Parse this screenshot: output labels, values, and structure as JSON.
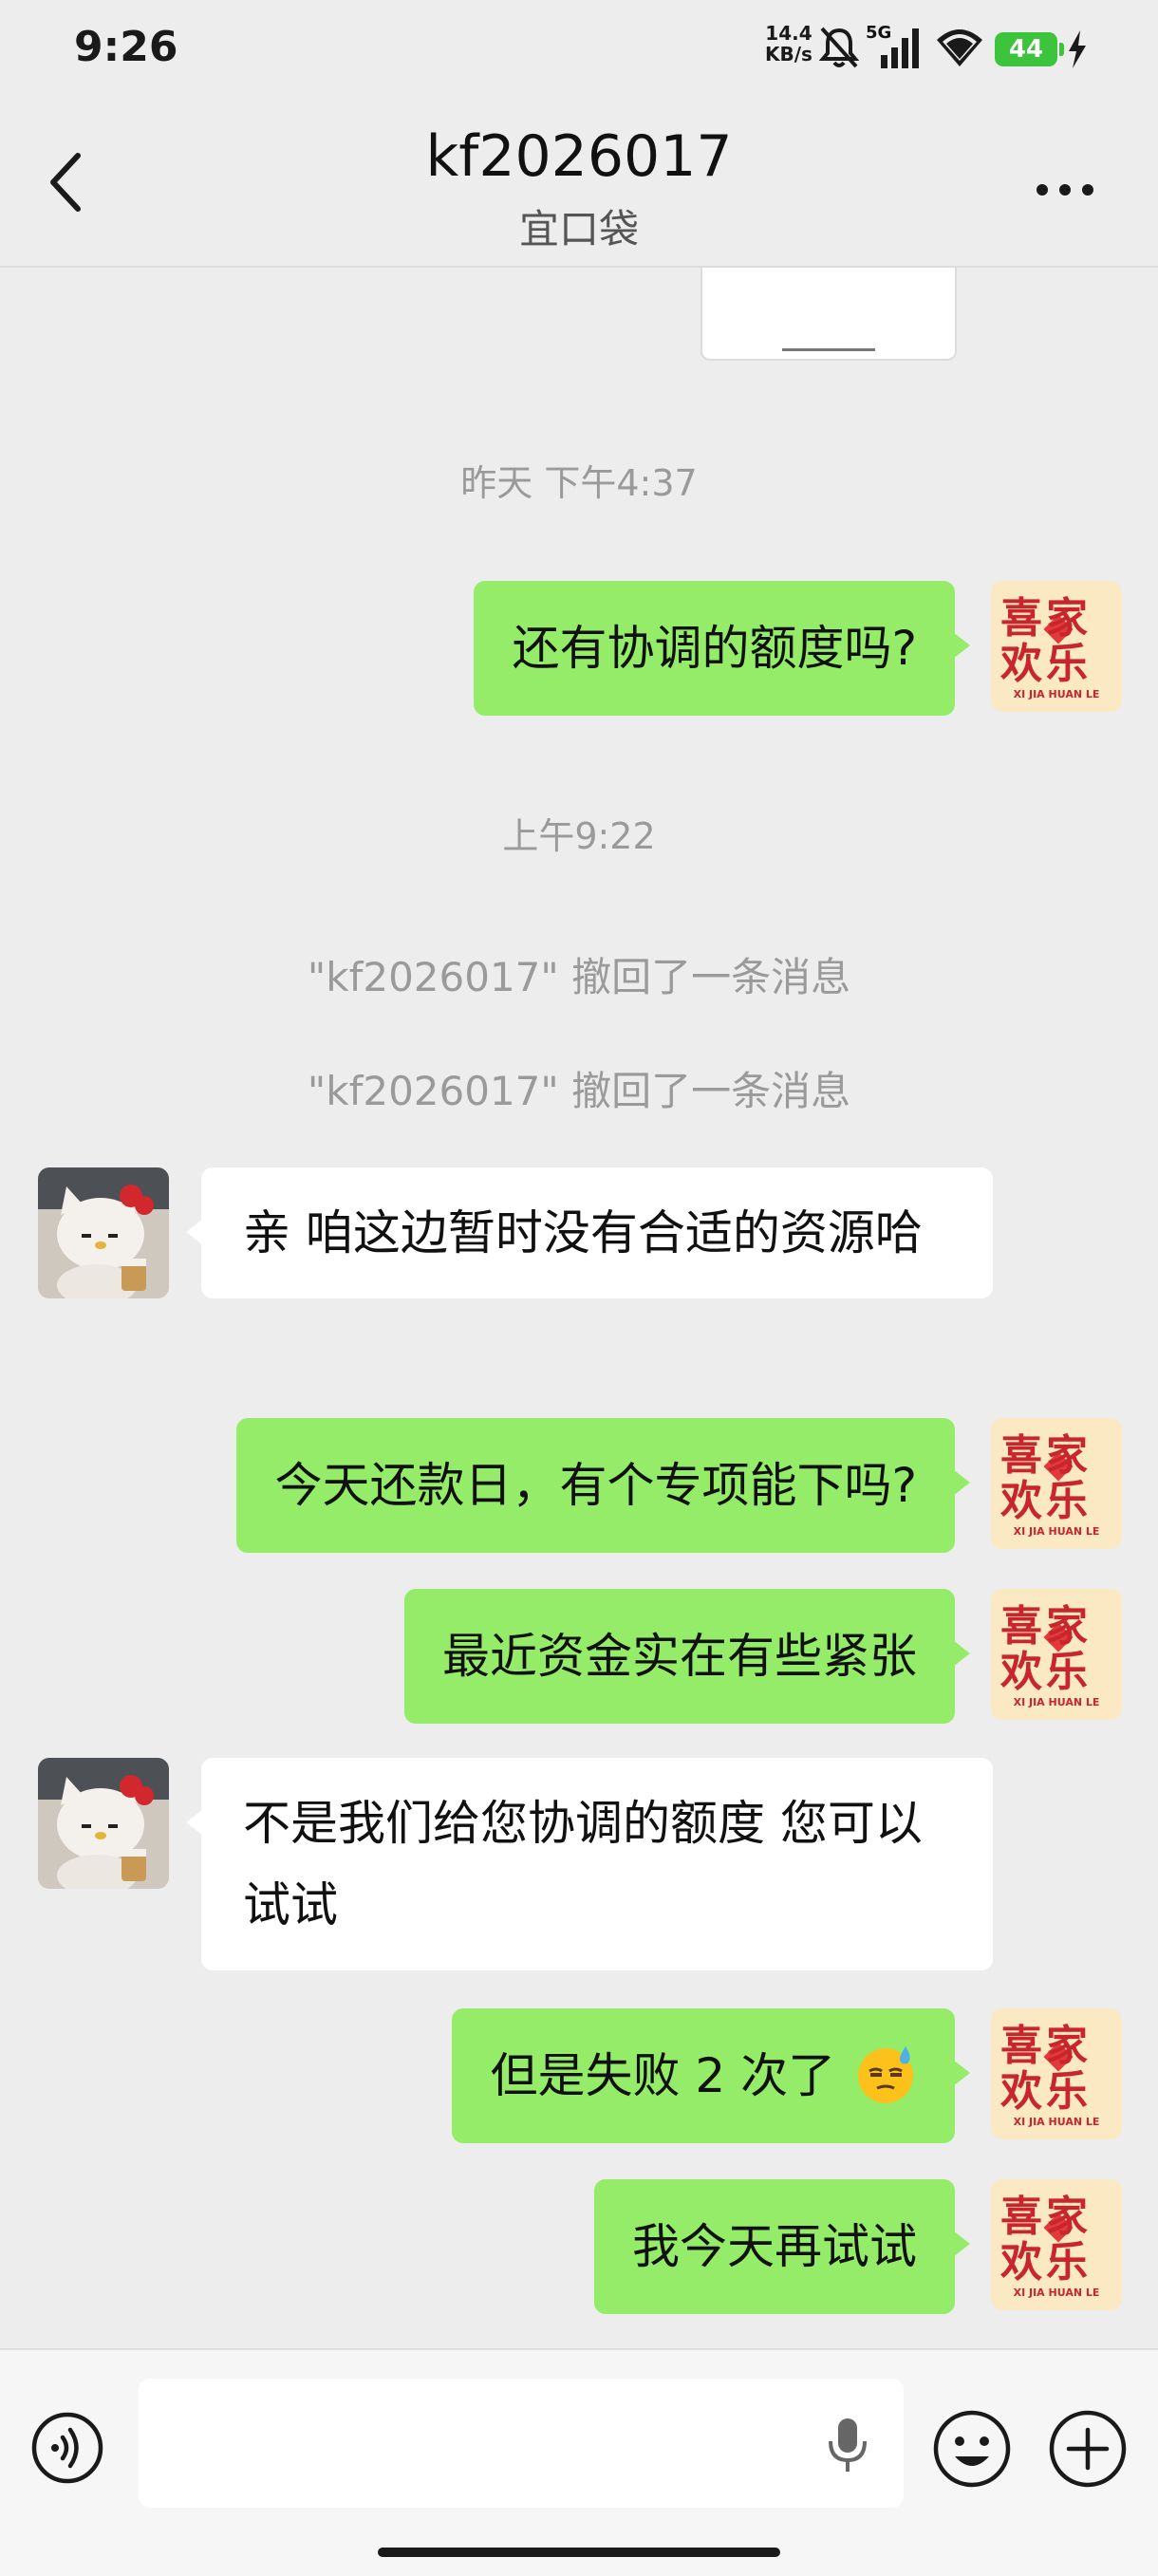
{
  "status_bar": {
    "time": "9:26",
    "speed_value": "14.4",
    "speed_unit": "KB/s",
    "network": "5G",
    "battery": "44",
    "icons": [
      "mute-icon",
      "signal-icon",
      "wifi-icon",
      "battery-icon",
      "charging-icon"
    ]
  },
  "header": {
    "title": "kf2026017",
    "subtitle": "宜口袋"
  },
  "messages": {
    "ts1": "昨天 下午4:37",
    "m1": "还有协调的额度吗?",
    "ts2": "上午9:22",
    "sys1": "\"kf2026017\" 撤回了一条消息",
    "sys2": "\"kf2026017\" 撤回了一条消息",
    "m2": "亲 咱这边暂时没有合适的资源哈",
    "m3": "今天还款日，有个专项能下吗?",
    "m4": "最近资金实在有些紧张",
    "m5": "不是我们给您协调的额度 您可以试试",
    "m6": "但是失败 2 次了",
    "m7": "我今天再试试"
  },
  "avatars": {
    "me_chars": "喜家欢乐",
    "me_pinyin": "XI JIA HUAN LE"
  },
  "colors": {
    "outgoing_bubble": "#95ec69",
    "incoming_bubble": "#ffffff",
    "background": "#ededed"
  }
}
